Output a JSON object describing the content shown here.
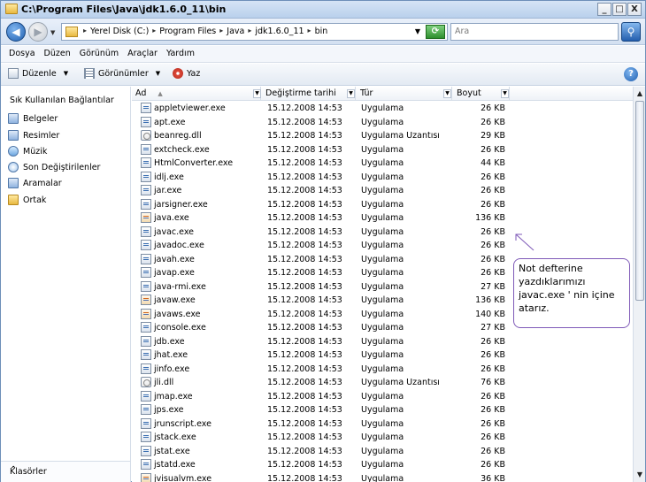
{
  "window": {
    "title": "C:\\Program Files\\Java\\jdk1.6.0_11\\bin",
    "buttons": {
      "minimize": "_",
      "maximize": "□",
      "close": "X"
    }
  },
  "address": {
    "crumbs": [
      "Yerel Disk (C:)",
      "Program Files",
      "Java",
      "jdk1.6.0_11",
      "bin"
    ],
    "search_placeholder": "Ara"
  },
  "menu": [
    "Dosya",
    "Düzen",
    "Görünüm",
    "Araçlar",
    "Yardım"
  ],
  "toolbar": {
    "organize": "Düzenle",
    "views": "Görünümler",
    "burn": "Yaz"
  },
  "sidebar": {
    "header": "Sık Kullanılan Bağlantılar",
    "items": [
      {
        "label": "Belgeler",
        "icon": "documents-icon"
      },
      {
        "label": "Resimler",
        "icon": "pictures-icon"
      },
      {
        "label": "Müzik",
        "icon": "music-icon"
      },
      {
        "label": "Son Değiştirilenler",
        "icon": "recent-icon"
      },
      {
        "label": "Aramalar",
        "icon": "searches-icon"
      },
      {
        "label": "Ortak",
        "icon": "folder-icon"
      }
    ],
    "folders_label": "Klasörler"
  },
  "columns": {
    "name": "Ad",
    "date": "Değiştirme tarihi",
    "type": "Tür",
    "size": "Boyut"
  },
  "files": [
    {
      "name": "appletviewer.exe",
      "date": "15.12.2008 14:53",
      "type": "Uygulama",
      "size": "26 KB",
      "icon": "exe"
    },
    {
      "name": "apt.exe",
      "date": "15.12.2008 14:53",
      "type": "Uygulama",
      "size": "26 KB",
      "icon": "exe"
    },
    {
      "name": "beanreg.dll",
      "date": "15.12.2008 14:53",
      "type": "Uygulama Uzantısı",
      "size": "29 KB",
      "icon": "dll"
    },
    {
      "name": "extcheck.exe",
      "date": "15.12.2008 14:53",
      "type": "Uygulama",
      "size": "26 KB",
      "icon": "exe"
    },
    {
      "name": "HtmlConverter.exe",
      "date": "15.12.2008 14:53",
      "type": "Uygulama",
      "size": "44 KB",
      "icon": "exe"
    },
    {
      "name": "idlj.exe",
      "date": "15.12.2008 14:53",
      "type": "Uygulama",
      "size": "26 KB",
      "icon": "exe"
    },
    {
      "name": "jar.exe",
      "date": "15.12.2008 14:53",
      "type": "Uygulama",
      "size": "26 KB",
      "icon": "exe"
    },
    {
      "name": "jarsigner.exe",
      "date": "15.12.2008 14:53",
      "type": "Uygulama",
      "size": "26 KB",
      "icon": "exe"
    },
    {
      "name": "java.exe",
      "date": "15.12.2008 14:53",
      "type": "Uygulama",
      "size": "136 KB",
      "icon": "java"
    },
    {
      "name": "javac.exe",
      "date": "15.12.2008 14:53",
      "type": "Uygulama",
      "size": "26 KB",
      "icon": "exe"
    },
    {
      "name": "javadoc.exe",
      "date": "15.12.2008 14:53",
      "type": "Uygulama",
      "size": "26 KB",
      "icon": "exe"
    },
    {
      "name": "javah.exe",
      "date": "15.12.2008 14:53",
      "type": "Uygulama",
      "size": "26 KB",
      "icon": "exe"
    },
    {
      "name": "javap.exe",
      "date": "15.12.2008 14:53",
      "type": "Uygulama",
      "size": "26 KB",
      "icon": "exe"
    },
    {
      "name": "java-rmi.exe",
      "date": "15.12.2008 14:53",
      "type": "Uygulama",
      "size": "27 KB",
      "icon": "exe"
    },
    {
      "name": "javaw.exe",
      "date": "15.12.2008 14:53",
      "type": "Uygulama",
      "size": "136 KB",
      "icon": "java"
    },
    {
      "name": "javaws.exe",
      "date": "15.12.2008 14:53",
      "type": "Uygulama",
      "size": "140 KB",
      "icon": "java"
    },
    {
      "name": "jconsole.exe",
      "date": "15.12.2008 14:53",
      "type": "Uygulama",
      "size": "27 KB",
      "icon": "exe"
    },
    {
      "name": "jdb.exe",
      "date": "15.12.2008 14:53",
      "type": "Uygulama",
      "size": "26 KB",
      "icon": "exe"
    },
    {
      "name": "jhat.exe",
      "date": "15.12.2008 14:53",
      "type": "Uygulama",
      "size": "26 KB",
      "icon": "exe"
    },
    {
      "name": "jinfo.exe",
      "date": "15.12.2008 14:53",
      "type": "Uygulama",
      "size": "26 KB",
      "icon": "exe"
    },
    {
      "name": "jli.dll",
      "date": "15.12.2008 14:53",
      "type": "Uygulama Uzantısı",
      "size": "76 KB",
      "icon": "dll"
    },
    {
      "name": "jmap.exe",
      "date": "15.12.2008 14:53",
      "type": "Uygulama",
      "size": "26 KB",
      "icon": "exe"
    },
    {
      "name": "jps.exe",
      "date": "15.12.2008 14:53",
      "type": "Uygulama",
      "size": "26 KB",
      "icon": "exe"
    },
    {
      "name": "jrunscript.exe",
      "date": "15.12.2008 14:53",
      "type": "Uygulama",
      "size": "26 KB",
      "icon": "exe"
    },
    {
      "name": "jstack.exe",
      "date": "15.12.2008 14:53",
      "type": "Uygulama",
      "size": "26 KB",
      "icon": "exe"
    },
    {
      "name": "jstat.exe",
      "date": "15.12.2008 14:53",
      "type": "Uygulama",
      "size": "26 KB",
      "icon": "exe"
    },
    {
      "name": "jstatd.exe",
      "date": "15.12.2008 14:53",
      "type": "Uygulama",
      "size": "26 KB",
      "icon": "exe"
    },
    {
      "name": "jvisualvm.exe",
      "date": "15.12.2008 14:53",
      "type": "Uygulama",
      "size": "36 KB",
      "icon": "java"
    }
  ],
  "annotation": {
    "text": "Not defterine yazdıklarımızı javac.exe ' nin içine atarız.",
    "color": "#7f5ab8"
  }
}
